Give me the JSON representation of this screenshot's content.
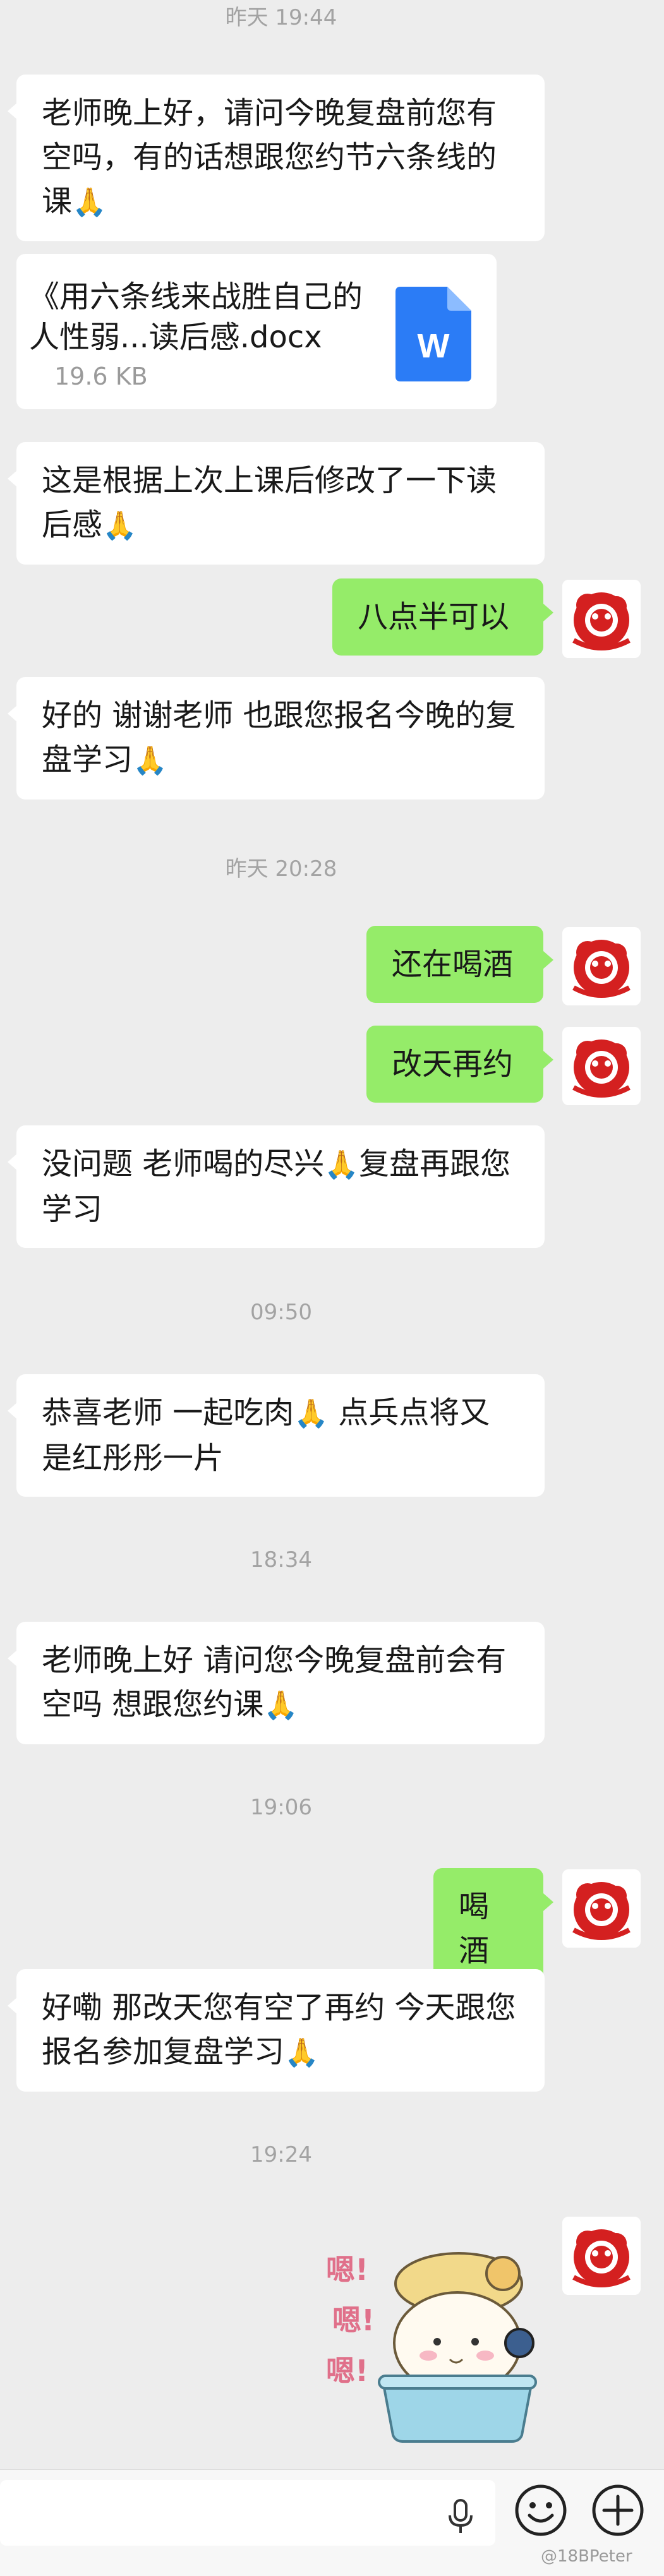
{
  "timestamps": {
    "t1": "昨天 19:44",
    "t2": "昨天 20:28",
    "t3": "09:50",
    "t4": "18:34",
    "t5": "19:06",
    "t6": "19:24"
  },
  "messages": {
    "m1": "老师晚上好，请问今晚复盘前您有空吗，有的话想跟您约节六条线的课",
    "m3": "这是根据上次上课后修改了一下读后感",
    "m4": "八点半可以",
    "m5": "好的 谢谢老师 也跟您报名今晚的复盘学习",
    "m6": "还在喝酒",
    "m7": "改天再约",
    "m8a": "没问题 老师喝的尽兴",
    "m8b": "复盘再跟您学习",
    "m9a": "恭喜老师 一起吃肉",
    "m9b": " 点兵点将又是红彤彤一片",
    "m10": "老师晚上好 请问您今晚复盘前会有空吗 想跟您约课",
    "m11": "喝酒",
    "m12": "好嘞 那改天您有空了再约 今天跟您报名参加复盘学习"
  },
  "file": {
    "name": "《用六条线来战胜自己的人性弱...读后感.docx",
    "size": "19.6 KB",
    "icon_letter": "W"
  },
  "emoji": {
    "pray": "🙏"
  },
  "sticker": {
    "text": [
      "嗯!",
      "嗯!",
      "嗯!"
    ]
  },
  "watermark": "@18BPeter",
  "colors": {
    "background": "#ededed",
    "bubble_self": "#95ec69",
    "bubble_other": "#ffffff",
    "word_icon": "#2b7cf6"
  },
  "icons": [
    "voice-icon",
    "emoji-icon",
    "plus-icon",
    "word-doc-icon"
  ]
}
